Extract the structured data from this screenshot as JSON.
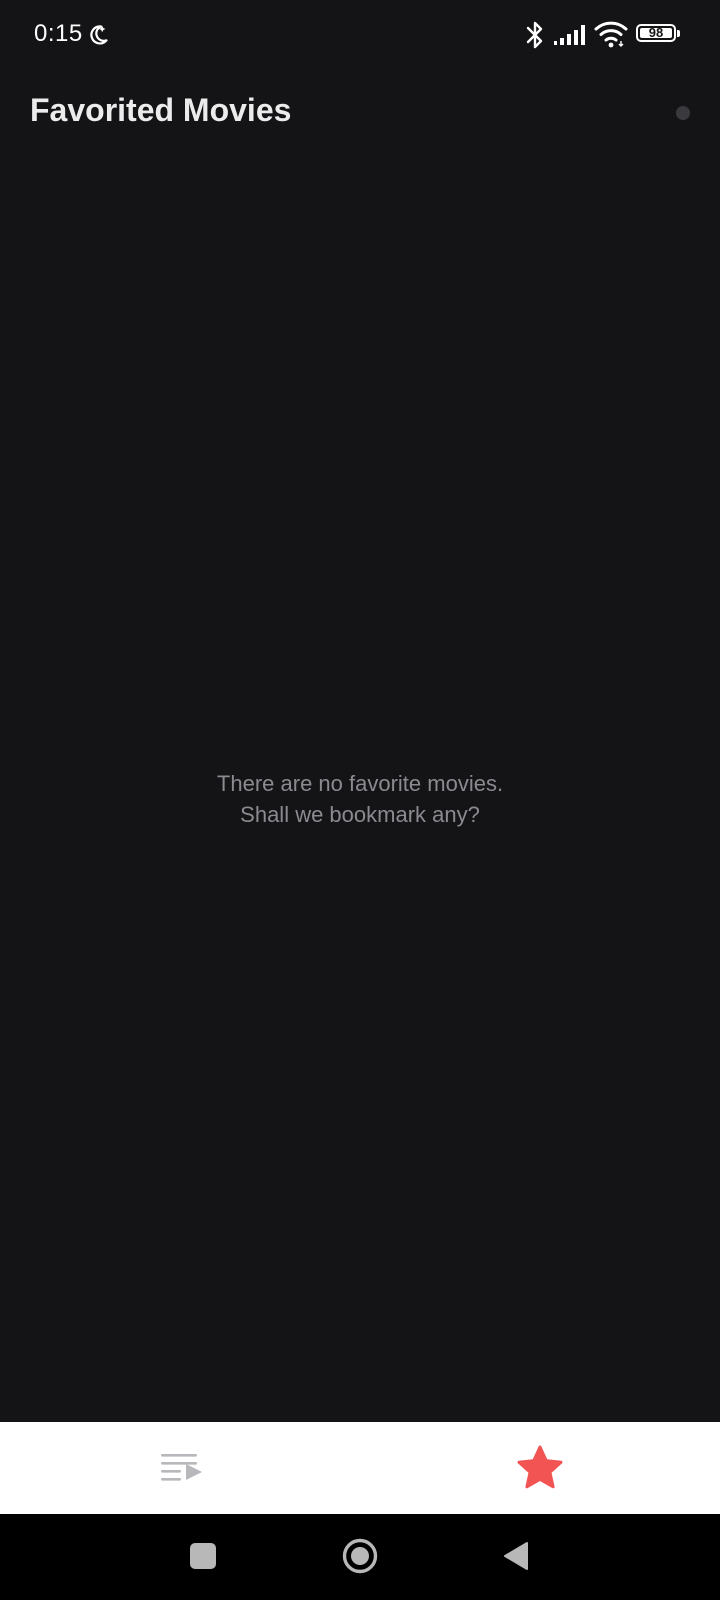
{
  "status_bar": {
    "time": "0:15",
    "battery": "98",
    "icons": [
      "moon-icon",
      "bluetooth-icon",
      "signal-icon",
      "wifi-icon",
      "battery-icon"
    ]
  },
  "header": {
    "title": "Favorited Movies"
  },
  "empty_state": {
    "line1": "There are no favorite movies.",
    "line2": "Shall we bookmark any?"
  },
  "tab_bar": {
    "tabs": [
      {
        "icon": "playlist-icon",
        "selected": false
      },
      {
        "icon": "star-icon",
        "selected": true
      }
    ]
  },
  "nav_bar": {
    "icons": [
      "recents-icon",
      "home-icon",
      "back-icon"
    ]
  },
  "colors": {
    "background": "#141416",
    "title": "#ececec",
    "empty_text": "#8a8a90",
    "tab_bar_bg": "#ffffff",
    "accent_star": "#f25454",
    "inactive_icon": "#b8b8bc"
  }
}
